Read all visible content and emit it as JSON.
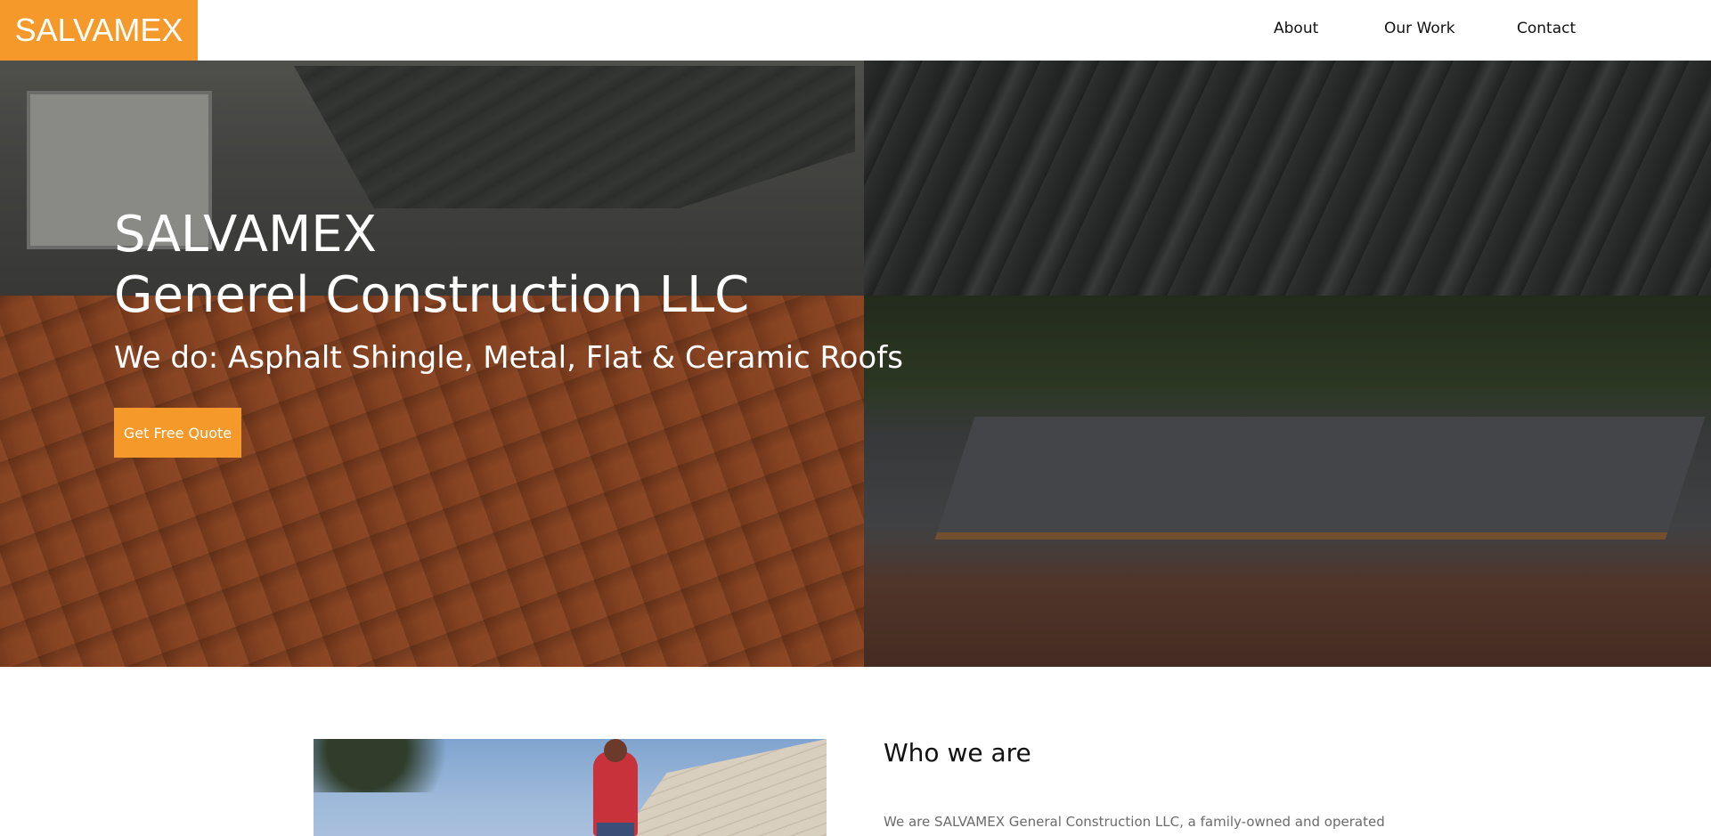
{
  "header": {
    "logo": "SALVAMEX",
    "nav": [
      {
        "label": "About"
      },
      {
        "label": "Our Work"
      },
      {
        "label": "Contact"
      }
    ]
  },
  "hero": {
    "title_line1": "SALVAMEX",
    "title_line2": "Generel Construction LLC",
    "subtitle": "We do: Asphalt Shingle, Metal, Flat & Ceramic Roofs",
    "cta_label": "Get Free Quote"
  },
  "about": {
    "heading": "Who we are",
    "text": "We are SALVAMEX General Construction LLC, a family-owned and operated"
  },
  "colors": {
    "accent": "#f59a2a"
  }
}
